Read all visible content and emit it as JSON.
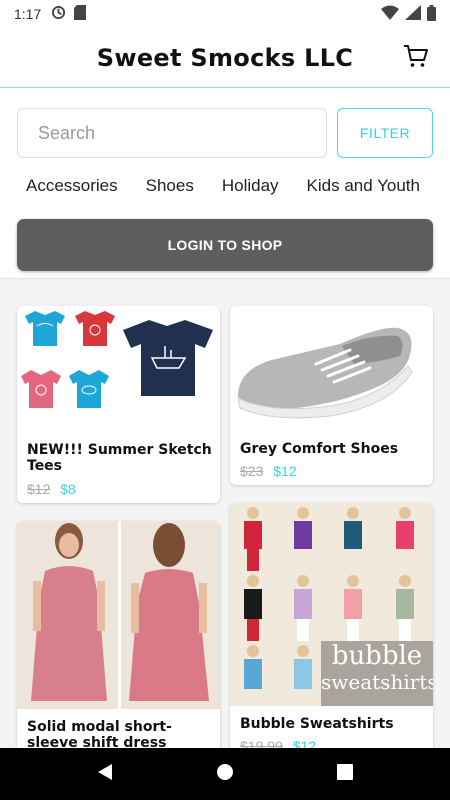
{
  "status_bar": {
    "time": "1:17"
  },
  "header": {
    "title": "Sweet Smocks LLC"
  },
  "search": {
    "placeholder": "Search",
    "filter_label": "FILTER"
  },
  "categories": [
    "Accessories",
    "Shoes",
    "Holiday",
    "Kids and Youth"
  ],
  "login": {
    "label": "LOGIN TO SHOP"
  },
  "products": [
    {
      "name": "NEW!!!  Summer Sketch Tees",
      "old_price": "$12",
      "price": "$8"
    },
    {
      "name": "Grey Comfort Shoes",
      "old_price": "$23",
      "price": "$12"
    },
    {
      "name": "Solid modal short-sleeve shift dress",
      "old_price": "",
      "price": ""
    },
    {
      "name": "Bubble Sweatshirts",
      "old_price": "$19.99",
      "price": "$12",
      "image_text": "bubble sweatshirts"
    }
  ],
  "colors": {
    "accent": "#34d6de",
    "login_bg": "#5e5e5e",
    "nav_bg": "#000000"
  },
  "icons": [
    "cart-icon",
    "back-icon",
    "home-icon",
    "recents-icon"
  ]
}
